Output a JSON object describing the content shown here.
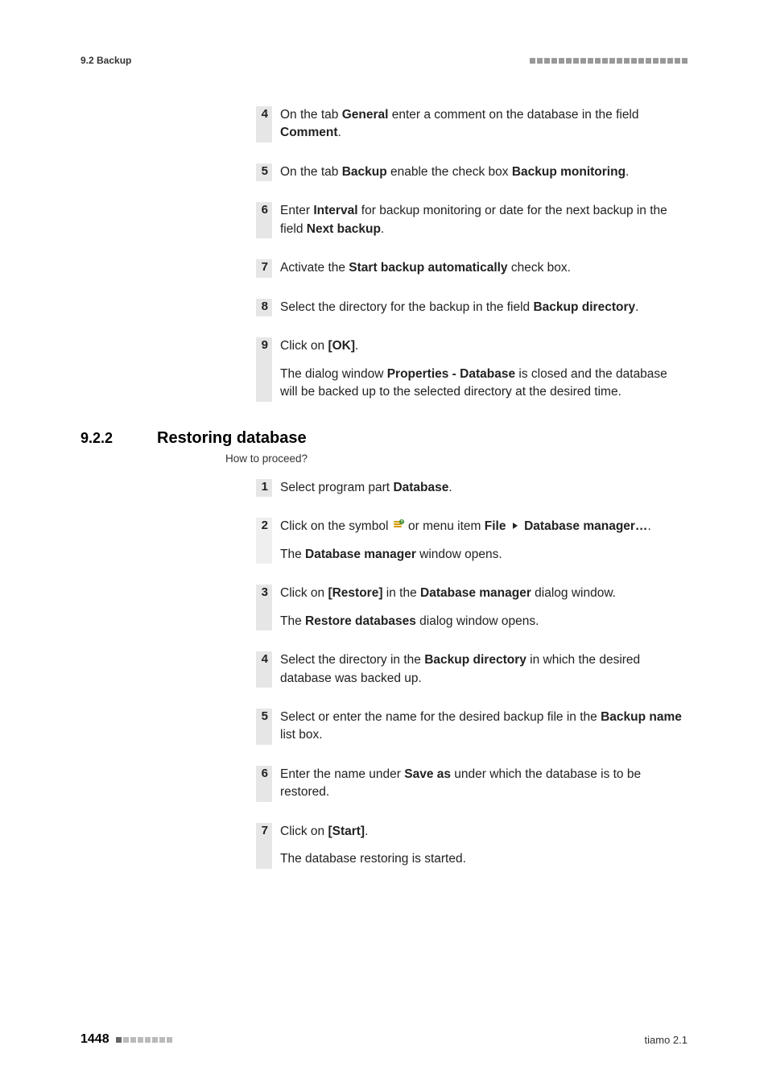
{
  "header": {
    "left": "9.2 Backup"
  },
  "steps_a": [
    {
      "n": "4",
      "segments": [
        "On the tab ",
        {
          "b": "General"
        },
        " enter a comment on the database in the field ",
        {
          "b": "Comment"
        },
        "."
      ]
    },
    {
      "n": "5",
      "segments": [
        "On the tab ",
        {
          "b": "Backup"
        },
        " enable the check box ",
        {
          "b": "Backup monitoring"
        },
        "."
      ]
    },
    {
      "n": "6",
      "segments": [
        "Enter ",
        {
          "b": "Interval"
        },
        " for backup monitoring or date for the next backup in the field ",
        {
          "b": "Next backup"
        },
        "."
      ]
    },
    {
      "n": "7",
      "segments": [
        "Activate the ",
        {
          "b": "Start backup automatically"
        },
        " check box."
      ]
    },
    {
      "n": "8",
      "segments": [
        "Select the directory for the backup in the field ",
        {
          "b": "Backup directory"
        },
        "."
      ]
    },
    {
      "n": "9",
      "segments": [
        "Click on ",
        {
          "b": "[OK]"
        },
        "."
      ],
      "follow": [
        "The dialog window ",
        {
          "b": "Properties - Database"
        },
        " is closed and the database will be backed up to the selected directory at the desired time."
      ]
    }
  ],
  "section": {
    "num": "9.2.2",
    "title": "Restoring database",
    "howto": "How to proceed?"
  },
  "steps_b": [
    {
      "n": "1",
      "segments": [
        "Select program part ",
        {
          "b": "Database"
        },
        "."
      ]
    },
    {
      "n": "2",
      "light": true,
      "segments": [
        "Click on the symbol ",
        {
          "icon": "db-icon"
        },
        " or menu item ",
        {
          "b": "File"
        },
        " ",
        {
          "tri": true
        },
        " ",
        {
          "b": "Database manager…"
        },
        "."
      ],
      "follow": [
        "The ",
        {
          "b": "Database manager"
        },
        " window opens."
      ]
    },
    {
      "n": "3",
      "segments": [
        "Click on ",
        {
          "b": "[Restore]"
        },
        " in the ",
        {
          "b": "Database manager"
        },
        " dialog window."
      ],
      "follow": [
        "The ",
        {
          "b": "Restore databases"
        },
        " dialog window opens."
      ]
    },
    {
      "n": "4",
      "segments": [
        "Select the directory in the ",
        {
          "b": "Backup directory"
        },
        " in which the desired database was backed up."
      ]
    },
    {
      "n": "5",
      "segments": [
        "Select or enter the name for the desired backup file in the ",
        {
          "b": "Backup name"
        },
        " list box."
      ]
    },
    {
      "n": "6",
      "segments": [
        "Enter the name under ",
        {
          "b": "Save as"
        },
        " under which the database is to be restored."
      ]
    },
    {
      "n": "7",
      "segments": [
        "Click on ",
        {
          "b": "[Start]"
        },
        "."
      ],
      "follow": [
        "The database restoring is started."
      ]
    }
  ],
  "footer": {
    "page": "1448",
    "right": "tiamo 2.1"
  }
}
